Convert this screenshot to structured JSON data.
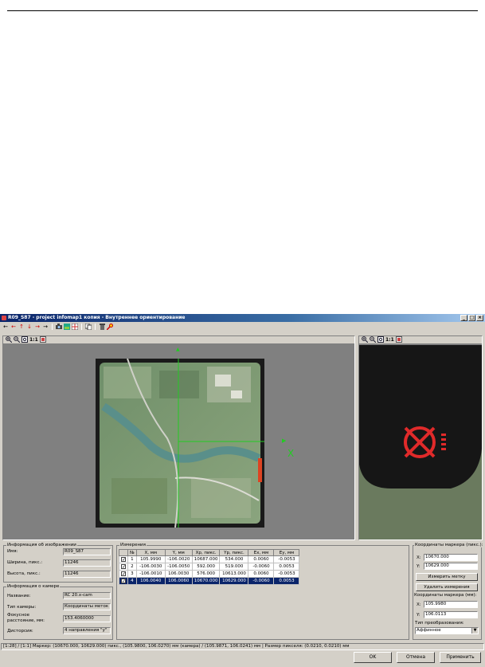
{
  "window": {
    "title": "R09_S87 - project infomap1 копия - Внутреннее ориентирование",
    "controls": [
      "_",
      "□",
      "×"
    ]
  },
  "toolbar": {
    "icons": [
      "arrow-left-icon",
      "arrow-left-red-icon",
      "arrow-up-red-icon",
      "arrow-down-red-icon",
      "arrow-right-red-icon",
      "arrow-right-icon",
      "camera-icon",
      "image-green-icon",
      "grid-icon",
      "copy-icon",
      "delete-icon",
      "marker-tool-icon"
    ]
  },
  "view_toolbar": {
    "ratio_label": "1:1"
  },
  "image_view": {
    "axis_x_label": "X",
    "colors": {
      "axis": "#22cc22",
      "frame": "#1a1a1a",
      "accent": "#dd2222"
    }
  },
  "image_info": {
    "title": "Информация об изображении",
    "name_label": "Имя:",
    "name_value": "R09_S87",
    "width_label": "Ширина, пикс.:",
    "width_value": "11246",
    "height_label": "Высота, пикс.:",
    "height_value": "11246"
  },
  "camera_info": {
    "title": "Информация о камере",
    "name_label": "Название:",
    "name_value": "RC 20.x-cam",
    "type_label": "Тип камеры:",
    "type_value": "Координаты меток",
    "focal_label_1": "Фокусное",
    "focal_label_2": "расстояние, мм:",
    "focal_value": "153.4060000",
    "distortion_label": "Дисторсия:",
    "distortion_value": "4 направления \"у\""
  },
  "measurements": {
    "title": "Измерения",
    "columns": [
      "№",
      "X, мм",
      "Y, мм",
      "Xp, пикс.",
      "Yp, пикс.",
      "Ex, мм",
      "Ey, мм"
    ],
    "rows": [
      {
        "checked": "✓",
        "cells": [
          "1",
          "105.9990",
          "-106.0020",
          "10687.000",
          "534.000",
          "0.0060",
          "-0.0053"
        ]
      },
      {
        "checked": "✓",
        "cells": [
          "2",
          "-106.0030",
          "-106.0050",
          "592.000",
          "519.000",
          "-0.0060",
          "0.0053"
        ]
      },
      {
        "checked": "✓",
        "cells": [
          "3",
          "-106.0010",
          "106.0030",
          "576.000",
          "10613.000",
          "0.0060",
          "-0.0053"
        ]
      },
      {
        "checked": "✓",
        "cells": [
          "4",
          "106.0040",
          "106.0060",
          "10670.000",
          "10629.000",
          "-0.0060",
          "0.0053"
        ]
      }
    ]
  },
  "marker_panel": {
    "pixel_title": "Координаты маркера (пикс.):",
    "x_label": "X:",
    "x_pix": "10670.000",
    "y_label": "Y:",
    "y_pix": "10629.000",
    "measure_button": "Измерить метку",
    "delete_button": "Удалить измерения",
    "mm_title": "Координаты маркера (мм):",
    "x_mm": "105.9980",
    "y_mm": "106.0113",
    "transform_label": "Тип преобразования:",
    "transform_value": "Аффинное"
  },
  "status_bar": {
    "text": "[1:28] / [1:1] Маркер: (10670.000, 10629.000) пикс., (105.9800, 106.0270) мм (камера) / (105.9871, 106.0241) мм | Размер пикселя: (0.0210, 0.0210) мм"
  },
  "buttons": {
    "ok": "OK",
    "cancel": "Отмена",
    "apply": "Применить"
  }
}
